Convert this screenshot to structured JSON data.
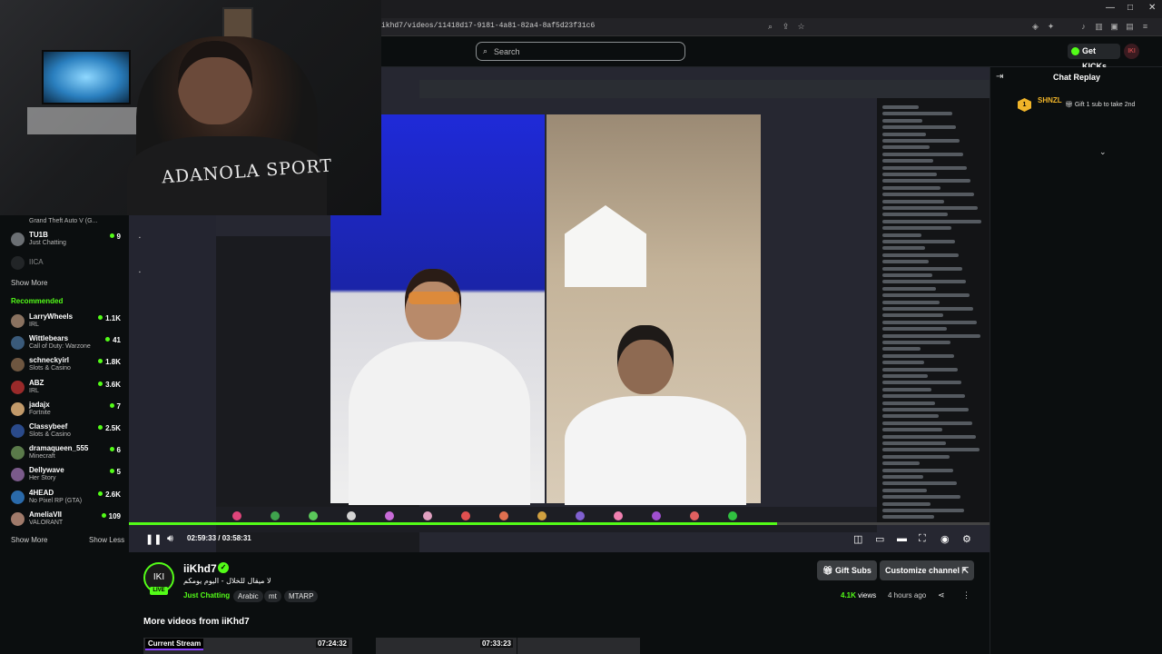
{
  "browser": {
    "url": "ikhd7/videos/11418d17-9181-4a81-82a4-8af5d23f31c6",
    "window_controls": [
      "—",
      "□",
      "✕"
    ]
  },
  "header": {
    "search_placeholder": "Search",
    "get_kicks_label": "Get KICKs",
    "avatar_text": "IKI"
  },
  "webcam": {
    "shirt_text": "ADANOLA SPORT"
  },
  "sidebar": {
    "partial_top_category": "Grand Theft Auto V (G...",
    "following": [
      {
        "name": "TU1B",
        "category": "Just Chatting",
        "viewers": "9",
        "color": "#6b6f73"
      },
      {
        "name": "IICA",
        "category": "",
        "viewers": "",
        "color": "#3a3d40"
      }
    ],
    "show_more_top": "Show More",
    "recommended_label": "Recommended",
    "recommended": [
      {
        "name": "LarryWheels",
        "category": "IRL",
        "viewers": "1.1K",
        "color": "#8a7260"
      },
      {
        "name": "Wittlebears",
        "category": "Call of Duty: Warzone",
        "viewers": "41",
        "color": "#3a5a7a"
      },
      {
        "name": "schneckyirl",
        "category": "Slots & Casino",
        "viewers": "1.8K",
        "color": "#6e5640"
      },
      {
        "name": "ABZ",
        "category": "IRL",
        "viewers": "3.6K",
        "color": "#9a2a2a"
      },
      {
        "name": "jadajx",
        "category": "Fortnite",
        "viewers": "7",
        "color": "#c29a6a"
      },
      {
        "name": "Classybeef",
        "category": "Slots & Casino",
        "viewers": "2.5K",
        "color": "#2a4a8a"
      },
      {
        "name": "dramaqueen_555",
        "category": "Minecraft",
        "viewers": "6",
        "color": "#5a7a4a"
      },
      {
        "name": "Dellywave",
        "category": "Her Story",
        "viewers": "5",
        "color": "#7a5a8a"
      },
      {
        "name": "4HEAD",
        "category": "No Pixel RP (GTA)",
        "viewers": "2.6K",
        "color": "#2a6aaa"
      },
      {
        "name": "AmeliaVII",
        "category": "VALORANT",
        "viewers": "109",
        "color": "#a07a6a"
      }
    ],
    "show_more_bottom": "Show More",
    "show_less": "Show Less"
  },
  "player": {
    "current_time": "02:59:33",
    "total_time": "03:58:31",
    "progress": 0.753
  },
  "chat": {
    "title": "Chat Replay",
    "pinned_name": "SHNZL",
    "pinned_count": "1",
    "pinned_text": "Gift 1 sub to take 2nd"
  },
  "channel": {
    "avatar_text": "IKI",
    "live_label": "LIVE",
    "name": "iiKhd7",
    "stream_title": "لا ميقال للخلال - اليوم يومكم",
    "category": "Just Chatting",
    "tags": [
      "Arabic",
      "mt",
      "MTARP"
    ],
    "gift_subs_label": "Gift Subs",
    "customize_label": "Customize channel",
    "views_count": "4.1K",
    "views_label": "views",
    "ago": "4 hours ago"
  },
  "more_videos": {
    "title": "More videos from iiKhd7",
    "current_stream_label": "Current Stream",
    "durations": [
      "07:24:32",
      "07:33:23"
    ]
  },
  "colors": {
    "accent": "#53fc18",
    "background": "#0b0e0f"
  }
}
